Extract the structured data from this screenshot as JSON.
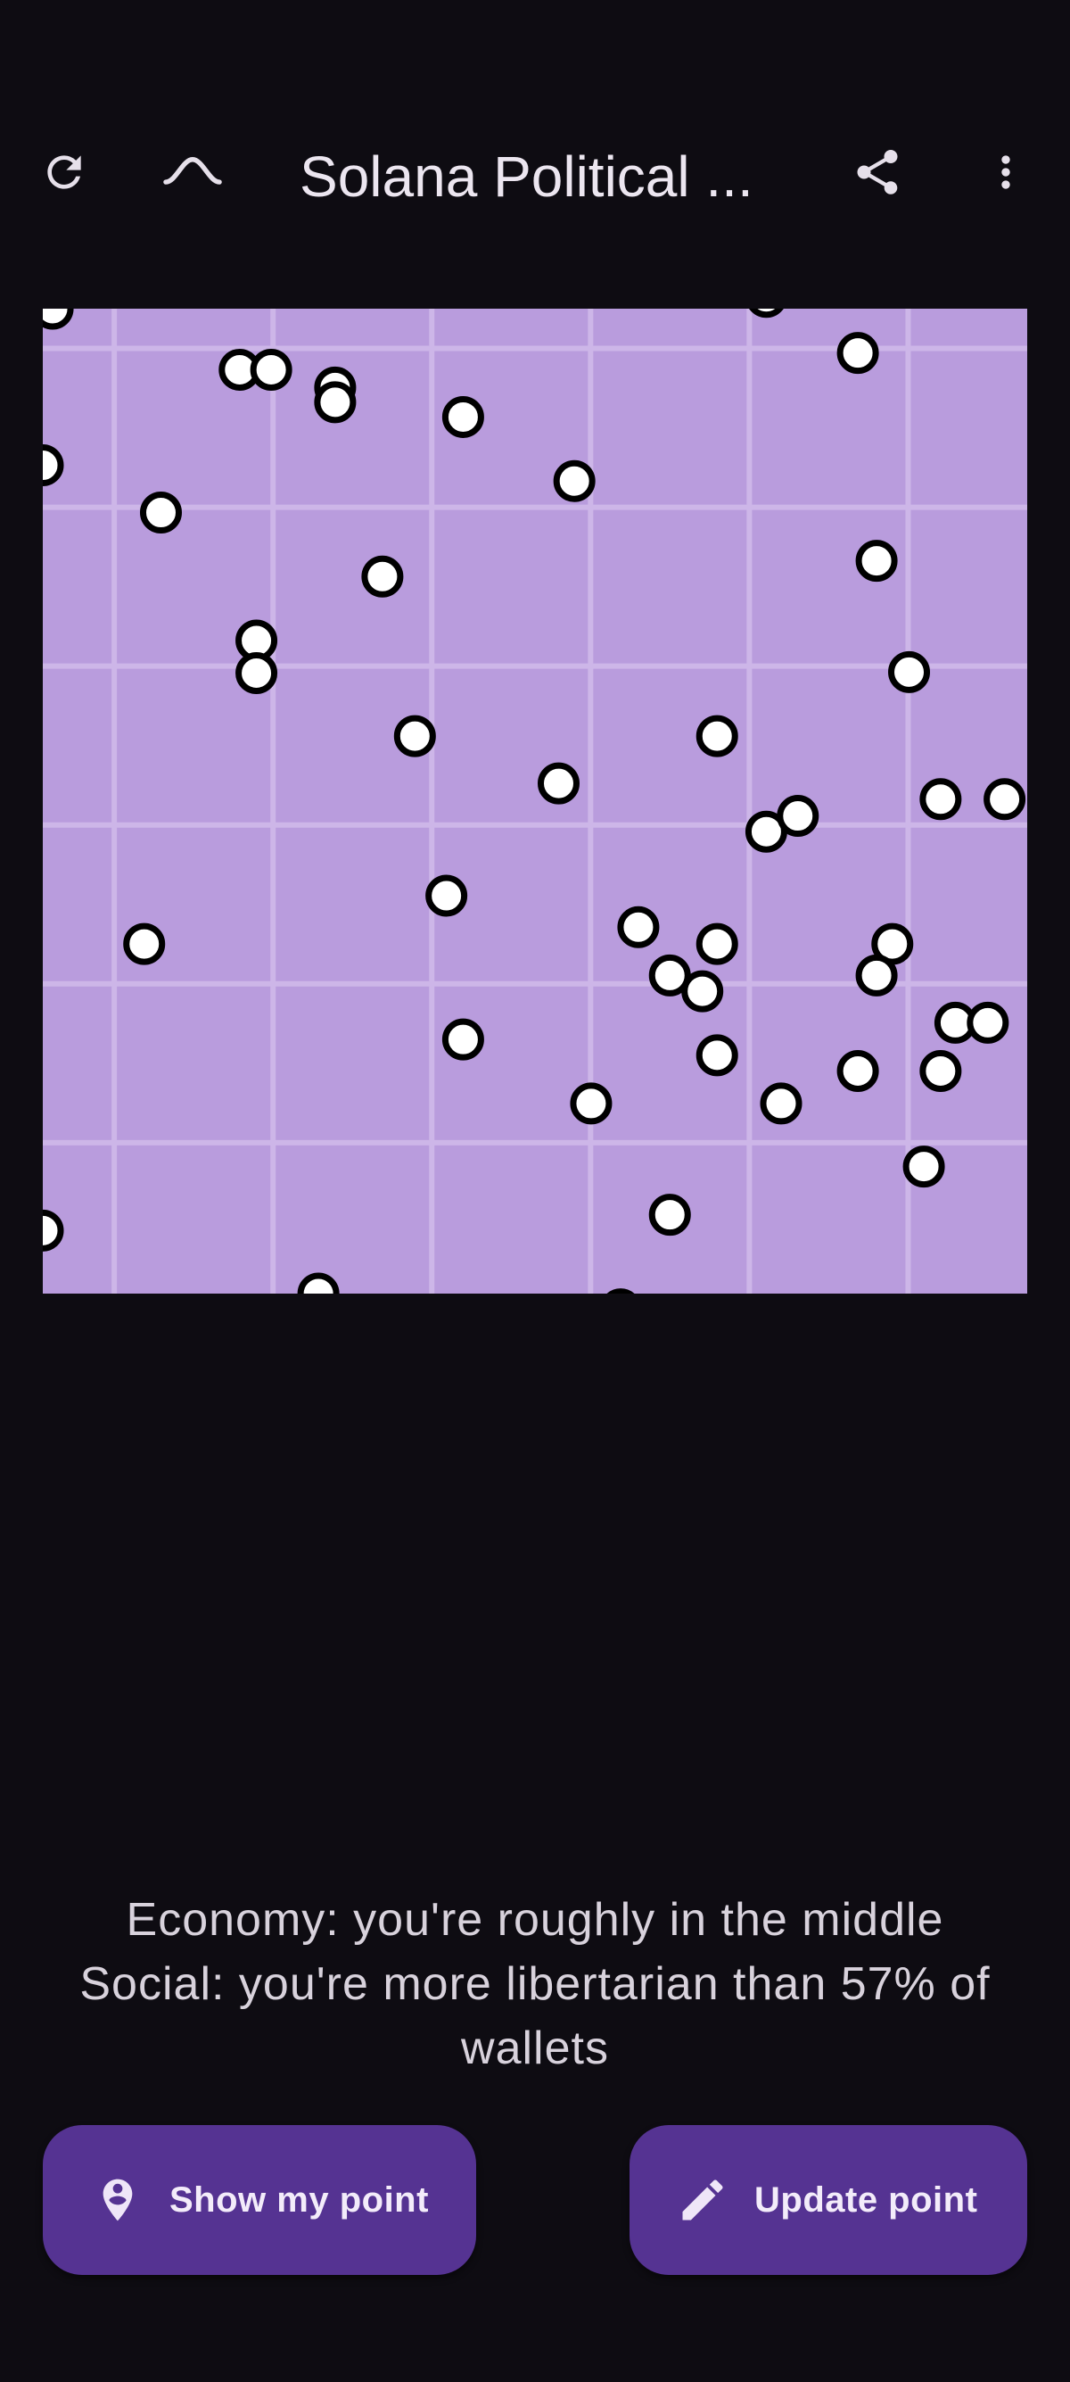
{
  "app_bar": {
    "title": "Solana Political ...",
    "icons": {
      "refresh": "refresh-icon",
      "toggle": "chevron-up-icon",
      "share": "share-icon",
      "menu": "more-vert-icon"
    }
  },
  "plot": {
    "background_color": "#b99cdd",
    "grid_color": "#cdb6e8",
    "point_fill": "#ffffff",
    "point_stroke": "#000000",
    "points": [
      [
        0.01,
        0.0
      ],
      [
        0.2,
        0.062
      ],
      [
        0.232,
        0.062
      ],
      [
        0.297,
        0.08
      ],
      [
        0.297,
        0.095
      ],
      [
        0.427,
        0.11
      ],
      [
        0.735,
        -0.012
      ],
      [
        0.828,
        0.045
      ],
      [
        0.0,
        0.159
      ],
      [
        0.12,
        0.207
      ],
      [
        0.54,
        0.175
      ],
      [
        0.345,
        0.272
      ],
      [
        0.217,
        0.337
      ],
      [
        0.217,
        0.37
      ],
      [
        0.847,
        0.256
      ],
      [
        0.88,
        0.369
      ],
      [
        0.378,
        0.434
      ],
      [
        0.685,
        0.434
      ],
      [
        0.524,
        0.482
      ],
      [
        0.735,
        0.531
      ],
      [
        0.767,
        0.515
      ],
      [
        0.912,
        0.498
      ],
      [
        0.977,
        0.498
      ],
      [
        0.41,
        0.596
      ],
      [
        0.103,
        0.645
      ],
      [
        0.605,
        0.628
      ],
      [
        0.685,
        0.645
      ],
      [
        0.637,
        0.677
      ],
      [
        0.67,
        0.693
      ],
      [
        0.863,
        0.645
      ],
      [
        0.847,
        0.677
      ],
      [
        0.927,
        0.725
      ],
      [
        0.96,
        0.725
      ],
      [
        0.427,
        0.742
      ],
      [
        0.685,
        0.758
      ],
      [
        0.557,
        0.807
      ],
      [
        0.75,
        0.807
      ],
      [
        0.828,
        0.774
      ],
      [
        0.912,
        0.774
      ],
      [
        0.895,
        0.871
      ],
      [
        0.637,
        0.92
      ],
      [
        0.0,
        0.936
      ],
      [
        0.28,
        1.0
      ],
      [
        0.587,
        1.016
      ]
    ]
  },
  "summary": {
    "line1": "Economy: you're roughly in the middle",
    "line2": "Social: you're more libertarian than 57% of wallets"
  },
  "buttons": {
    "show_label": "Show my point",
    "update_label": "Update point",
    "background_color": "#553392"
  }
}
